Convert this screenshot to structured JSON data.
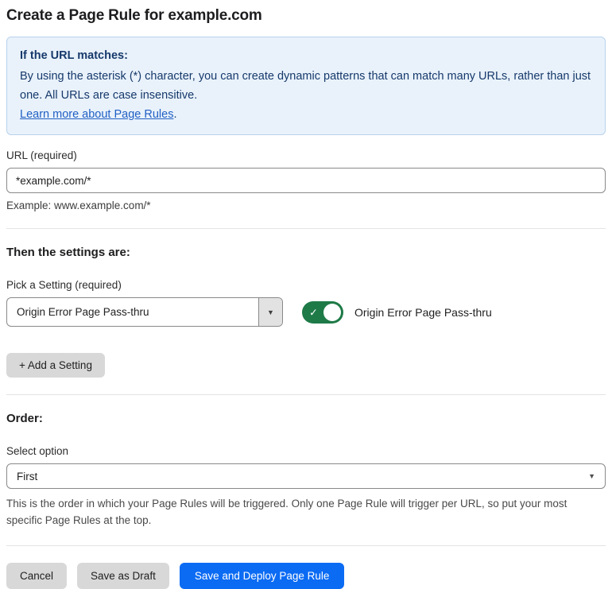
{
  "page": {
    "title": "Create a Page Rule for example.com"
  },
  "info_box": {
    "heading": "If the URL matches:",
    "body": "By using the asterisk (*) character, you can create dynamic patterns that can match many URLs, rather than just one. All URLs are case insensitive.",
    "link_label": "Learn more about Page Rules",
    "link_suffix": "."
  },
  "url_field": {
    "label": "URL (required)",
    "value": "*example.com/*",
    "helper": "Example: www.example.com/*"
  },
  "settings_section": {
    "heading": "Then the settings are:",
    "picker_label": "Pick a Setting (required)",
    "picker_value": "Origin Error Page Pass-thru",
    "toggle_state": "on",
    "toggle_label": "Origin Error Page Pass-thru",
    "add_setting_label": "+ Add a Setting"
  },
  "order_section": {
    "heading": "Order:",
    "select_label": "Select option",
    "select_value": "First",
    "helper": "This is the order in which your Page Rules will be triggered. Only one Page Rule will trigger per URL, so put your most specific Page Rules at the top."
  },
  "footer": {
    "cancel_label": "Cancel",
    "save_draft_label": "Save as Draft",
    "save_deploy_label": "Save and Deploy Page Rule"
  },
  "icons": {
    "chevron_down": "▼",
    "check": "✓"
  },
  "colors": {
    "accent_blue": "#0b6bf3",
    "info_bg": "#e9f2fb",
    "info_border": "#b9d2ec",
    "info_text": "#16396b",
    "link_blue": "#2160c4",
    "toggle_green": "#1e7a47",
    "button_gray": "#d8d8d8",
    "divider_gray": "#e3e3e3"
  }
}
